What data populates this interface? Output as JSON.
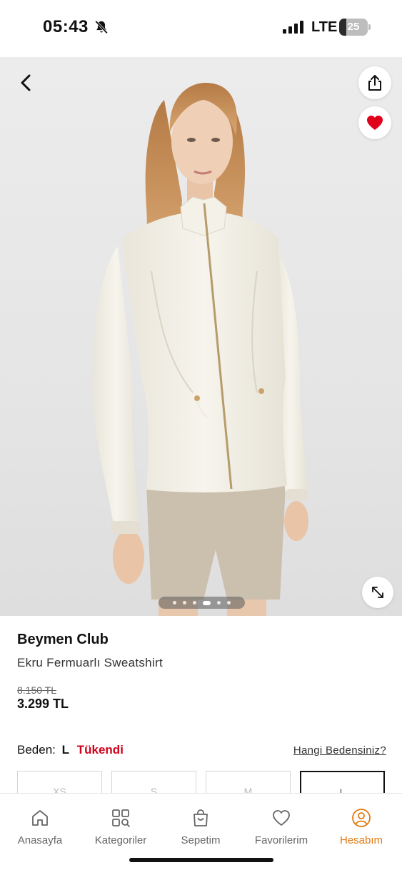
{
  "status_bar": {
    "time": "05:43",
    "network": "LTE",
    "battery_percent": "25",
    "battery_level": 0.25,
    "icons": [
      "bell-slash-icon",
      "signal-icon",
      "battery-icon"
    ]
  },
  "hero": {
    "image": "product-photo-model-wearing-ecru-zip-sweatshirt",
    "pager_count": 6,
    "pager_active_index": 3,
    "icons": [
      "chevron-left-icon",
      "share-icon",
      "heart-icon",
      "expand-icon"
    ],
    "favorite_color": "#e0001b"
  },
  "product": {
    "brand": "Beymen Club",
    "name": "Ekru Fermuarlı Sweatshirt",
    "old_price": "8.150 TL",
    "price": "3.299 TL"
  },
  "size": {
    "label": "Beden:",
    "selected": "L",
    "status": "Tükendi",
    "guide_link": "Hangi Bedensiniz?",
    "options": [
      "XS",
      "S",
      "M",
      "L"
    ],
    "selected_index": 3
  },
  "tab_bar": {
    "active_color": "#e07a12",
    "tabs": [
      {
        "label": "Anasayfa",
        "icon": "home-icon"
      },
      {
        "label": "Kategoriler",
        "icon": "categories-icon"
      },
      {
        "label": "Sepetim",
        "icon": "bag-icon"
      },
      {
        "label": "Favorilerim",
        "icon": "heart-outline-icon"
      },
      {
        "label": "Hesabım",
        "icon": "account-icon"
      }
    ],
    "active_index": 4
  }
}
